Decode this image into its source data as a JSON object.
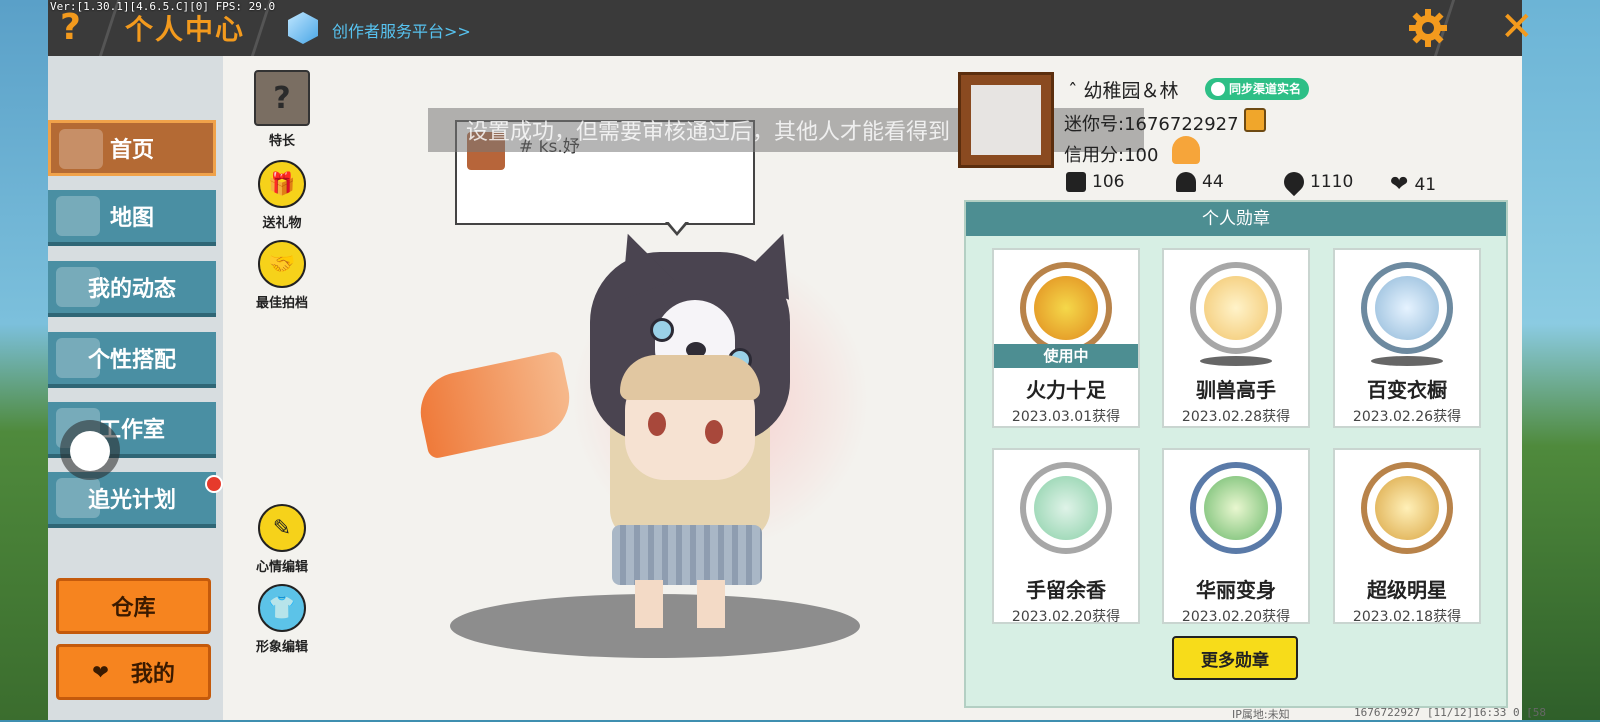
{
  "header": {
    "version_text": "Ver:[1.30.1][4.6.5.C][0] FPS: 29.0",
    "help_icon": "question-mark-icon",
    "title": "个人中心",
    "creator_link": "创作者服务平台>>",
    "settings_icon": "gear-icon",
    "close_icon": "close-x-icon",
    "accent_color": "#f39a1d"
  },
  "sidebar": {
    "items": [
      {
        "label": "首页",
        "active": true
      },
      {
        "label": "地图"
      },
      {
        "label": "我的动态"
      },
      {
        "label": "个性搭配"
      },
      {
        "label": "工作室"
      },
      {
        "label": "追光计划"
      }
    ],
    "warehouse_button": "仓库",
    "mine_button": "我的"
  },
  "tools": {
    "specialty": "特长",
    "specialty_icon": "?",
    "gift": "送礼物",
    "partner": "最佳拍档",
    "mood_edit": "心情编辑",
    "avatar_edit": "形象编辑"
  },
  "toast": "设置成功，但需要审核通过后，其他人才能看得到",
  "bubble": {
    "text": "# ks.妤"
  },
  "profile": {
    "nickname": "ˆ 幼稚园＆林",
    "real_name_badge": "同步渠道实名",
    "mini_id": "迷你号:1676722927",
    "credit": "信用分:100",
    "stats": [
      {
        "icon": "plus-icon",
        "value": "106"
      },
      {
        "icon": "fans-icon",
        "value": "44"
      },
      {
        "icon": "fire-icon",
        "value": "1110"
      },
      {
        "icon": "heart-icon",
        "value": "41"
      }
    ]
  },
  "medals": {
    "header": "个人勋章",
    "in_use_label": "使用中",
    "items": [
      {
        "name": "火力十足",
        "date": "2023.03.01获得",
        "in_use": true
      },
      {
        "name": "驯兽高手",
        "date": "2023.02.28获得"
      },
      {
        "name": "百变衣橱",
        "date": "2023.02.26获得"
      },
      {
        "name": "手留余香",
        "date": "2023.02.20获得"
      },
      {
        "name": "华丽变身",
        "date": "2023.02.20获得"
      },
      {
        "name": "超级明星",
        "date": "2023.02.18获得"
      }
    ],
    "more_button": "更多勋章"
  },
  "footer": {
    "ip_location": "IP属地:未知",
    "info": "1676722927  [11/12]16:33 0  [58"
  }
}
